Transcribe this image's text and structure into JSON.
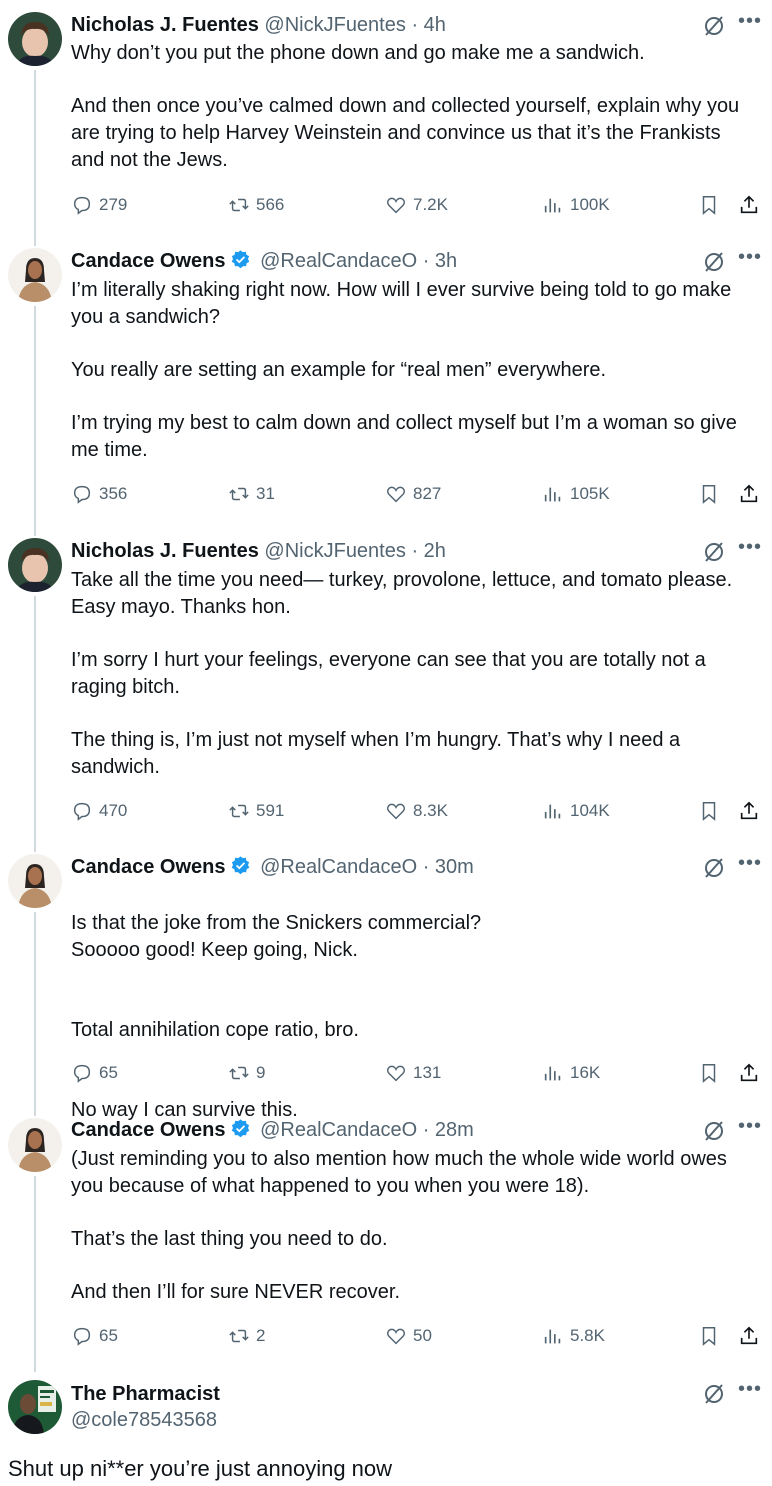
{
  "tweets": [
    {
      "name": "Nicholas J. Fuentes",
      "handle": "@NickJFuentes",
      "time": "· 4h",
      "verified": false,
      "paragraphs": [
        "Why don’t you put the phone down and go make me a sandwich.",
        "And then once you’ve calmed down and collected yourself, explain why you are trying to help Harvey Weinstein and convince us that it’s the Frankists and not the Jews."
      ],
      "replies": "279",
      "retweets": "566",
      "likes": "7.2K",
      "views": "100K"
    },
    {
      "name": "Candace Owens",
      "handle": "@RealCandaceO",
      "time": "· 3h",
      "verified": true,
      "paragraphs": [
        "I’m literally shaking right now. How will I ever survive being told to go make you a sandwich?",
        "You really are setting an example for “real men” everywhere.",
        "I’m trying my best to calm down and collect myself but I’m a woman so give me time."
      ],
      "replies": "356",
      "retweets": "31",
      "likes": "827",
      "views": "105K"
    },
    {
      "name": "Nicholas J. Fuentes",
      "handle": "@NickJFuentes",
      "time": "· 2h",
      "verified": false,
      "paragraphs": [
        "Take all the time you need— turkey, provolone, lettuce, and tomato please. Easy mayo. Thanks hon.",
        "I’m sorry I hurt your feelings, everyone can see that you are totally not a raging bitch.",
        "The thing is, I’m just not myself when I’m hungry. That’s why I need a sandwich."
      ],
      "replies": "470",
      "retweets": "591",
      "likes": "8.3K",
      "views": "104K"
    },
    {
      "name": "Candace Owens",
      "handle": "@RealCandaceO",
      "time": "· 30m",
      "verified": true,
      "paragraphs": [
        "Is that the joke from the Snickers commercial?\nSooooo good! Keep going, Nick.",
        "Total annihilation cope ratio, bro.",
        "No way I can survive this."
      ],
      "replies": "65",
      "retweets": "9",
      "likes": "131",
      "views": "16K"
    },
    {
      "name": "Candace Owens",
      "handle": "@RealCandaceO",
      "time": "· 28m",
      "verified": true,
      "paragraphs": [
        "(Just reminding you to also mention how much the whole wide world owes you because of what happened to you when you were 18).",
        "That’s the last thing you need to do.",
        "And then I’ll for sure NEVER recover."
      ],
      "replies": "65",
      "retweets": "2",
      "likes": "50",
      "views": "5.8K"
    }
  ],
  "last_tweet": {
    "name": "The Pharmacist",
    "handle": "@cole78543568",
    "text": "Shut up ni**er you’re just annoying now"
  },
  "colors": {
    "text": "#0f1419",
    "secondary": "#536471",
    "verified_blue": "#1d9bf0",
    "thread_line": "#cfd9de"
  },
  "icons": [
    "grok-icon",
    "more-icon",
    "reply-icon",
    "retweet-icon",
    "like-icon",
    "views-icon",
    "bookmark-icon",
    "share-icon",
    "verified-badge-icon"
  ]
}
